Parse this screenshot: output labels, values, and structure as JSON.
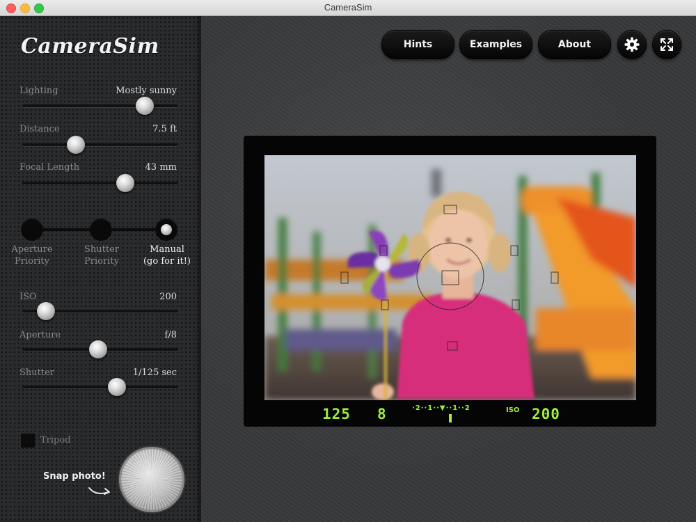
{
  "window": {
    "title": "CameraSim"
  },
  "sidebar": {
    "logo": "CameraSim",
    "scene_sliders": [
      {
        "label": "Lighting",
        "value": "Mostly sunny",
        "position": 0.78
      },
      {
        "label": "Distance",
        "value": "7.5 ft",
        "position": 0.34
      },
      {
        "label": "Focal Length",
        "value": "43 mm",
        "position": 0.66
      }
    ],
    "modes": [
      {
        "label": "Aperture\nPriority",
        "active": false
      },
      {
        "label": "Shutter\nPriority",
        "active": false
      },
      {
        "label": "Manual\n(go for it!)",
        "active": true
      }
    ],
    "exposure_sliders": [
      {
        "label": "ISO",
        "value": "200",
        "position": 0.15
      },
      {
        "label": "Aperture",
        "value": "f/8",
        "position": 0.49
      },
      {
        "label": "Shutter",
        "value": "1/125 sec",
        "position": 0.6
      }
    ],
    "tripod": {
      "label": "Tripod",
      "checked": false
    },
    "snap": {
      "label": "Snap photo!"
    }
  },
  "toolbar": {
    "hints": "Hints",
    "examples": "Examples",
    "about": "About"
  },
  "viewfinder": {
    "shutter": "125",
    "aperture": "8",
    "meter": "·2··1··▼··1··2",
    "iso_label": "ISO",
    "iso": "200",
    "lcd_color": "#9ff03a"
  }
}
